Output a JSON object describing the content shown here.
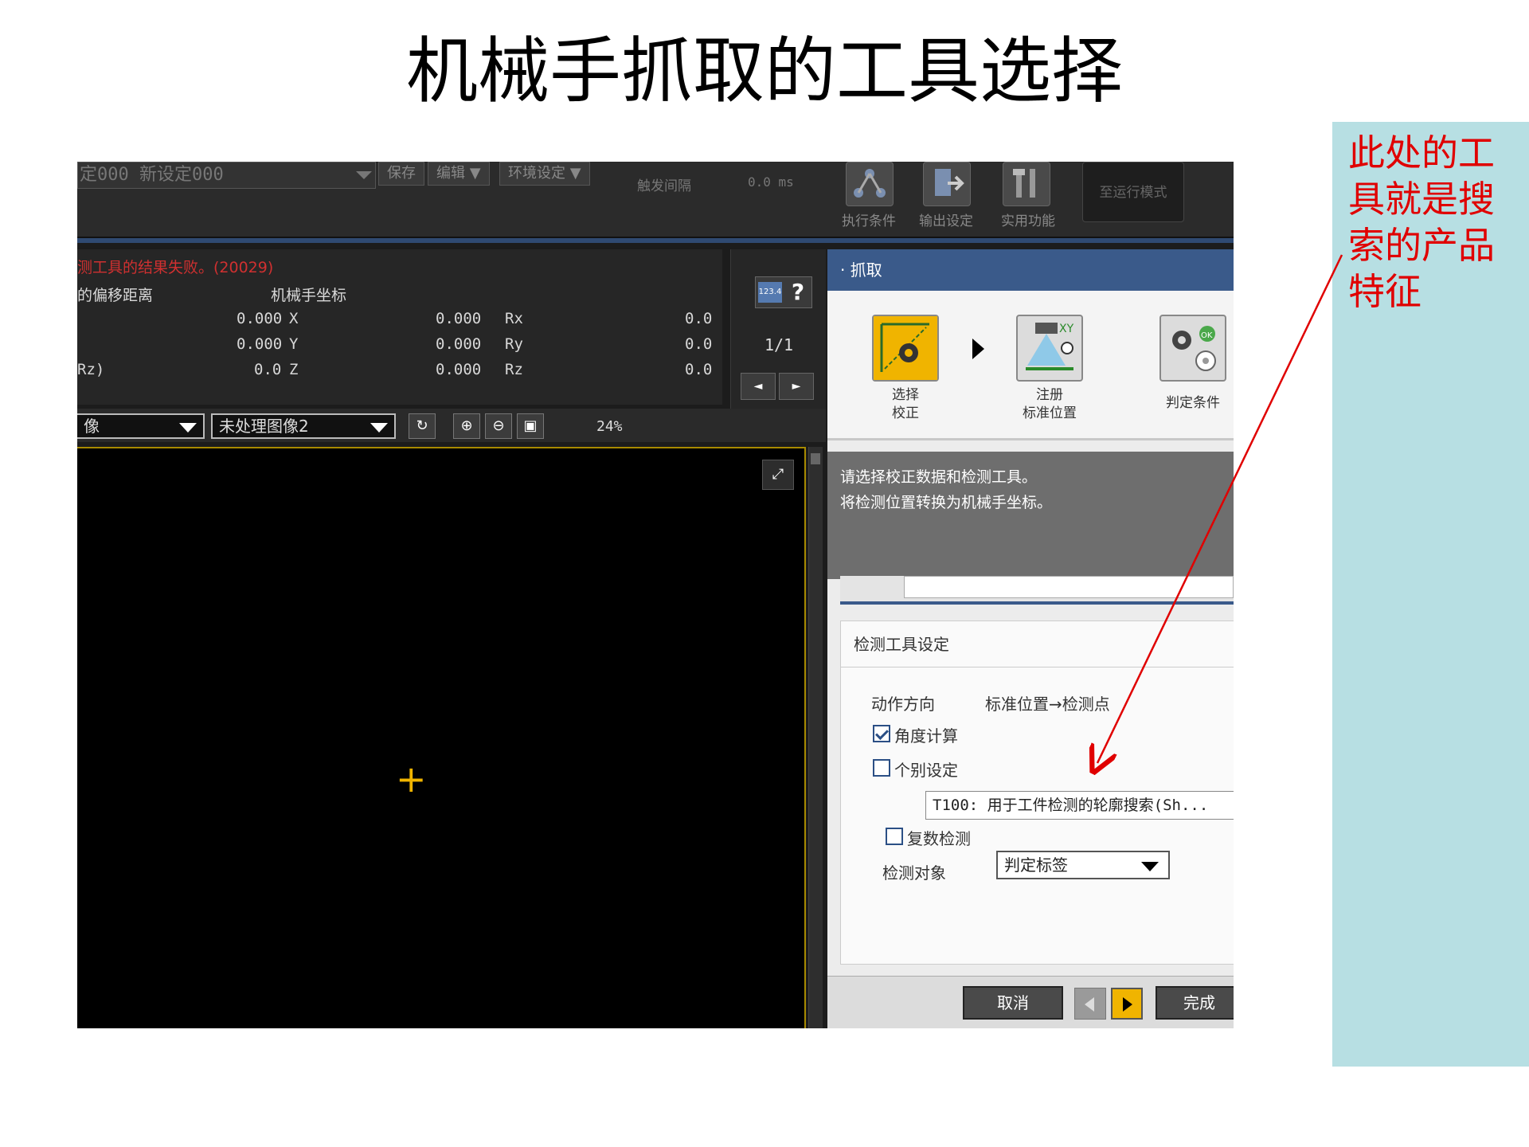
{
  "slide": {
    "title": "机械手抓取的工具选择",
    "note": "此处的工具就是搜索的产品特征",
    "colors": {
      "note_bg": "#b7dfe3",
      "note_text": "#e00000",
      "arrow": "#e00000"
    }
  },
  "toolbar": {
    "scene_select": "定000  新设定000",
    "save_label": "保存",
    "edit_label": "编辑 ▼",
    "env_label": "环境设定 ▼",
    "trigger_interval_label": "触发间隔",
    "trigger_interval_value": "0.0 ms",
    "exec_cond_label": "执行条件",
    "output_label": "输出设定",
    "util_label": "实用功能",
    "run_mode_label": "至运行模式"
  },
  "info": {
    "error_text": "测工具的结果失败。(20029)",
    "offset_header": "的偏移距离",
    "robot_header": "机械手坐标",
    "offset_values": [
      "0.000",
      "0.000",
      "0.0"
    ],
    "rz_label": "Rz)",
    "axes": [
      "X",
      "Y",
      "Z"
    ],
    "axis_values": [
      "0.000",
      "0.000",
      "0.000"
    ],
    "rot_axes": [
      "Rx",
      "Ry",
      "Rz"
    ],
    "rot_values": [
      "0.0",
      "0.0",
      "0.0"
    ]
  },
  "pager": {
    "num_icon": "123.4",
    "help": "?",
    "page": "1/1",
    "prev": "◄",
    "next": "►"
  },
  "image_bar": {
    "image_select_1": "像",
    "image_select_2": "未处理图像2",
    "refresh_icon": "↻",
    "zoom_in_icon": "⊕",
    "zoom_out_icon": "⊖",
    "fit_icon": "▣",
    "zoom": "24%"
  },
  "canvas": {
    "crosshair": "+",
    "fullscreen_icon": "⤢"
  },
  "panel": {
    "header": "· 抓取",
    "steps": [
      {
        "label1": "选择",
        "label2": "校正",
        "color": "#f0b400"
      },
      {
        "label1": "注册",
        "label2": "标准位置",
        "color": "#dcdcdc"
      },
      {
        "label1": "判定条件",
        "label2": "",
        "color": "#dcdcdc"
      }
    ],
    "description": [
      "请选择校正数据和检测工具。",
      "将检测位置转换为机械手坐标。"
    ],
    "section_title": "检测工具设定",
    "direction_label": "动作方向",
    "direction_value": "标准位置→检测点",
    "angle_calc": {
      "label": "角度计算",
      "checked": true
    },
    "individual": {
      "label": "个别设定",
      "checked": false
    },
    "tool_value": "T100: 用于工件检测的轮廓搜索(Sh...",
    "multi_detect": {
      "label": "复数检测",
      "checked": false
    },
    "target_label": "检测对象",
    "target_value": "判定标签",
    "cancel": "取消",
    "finish": "完成"
  }
}
